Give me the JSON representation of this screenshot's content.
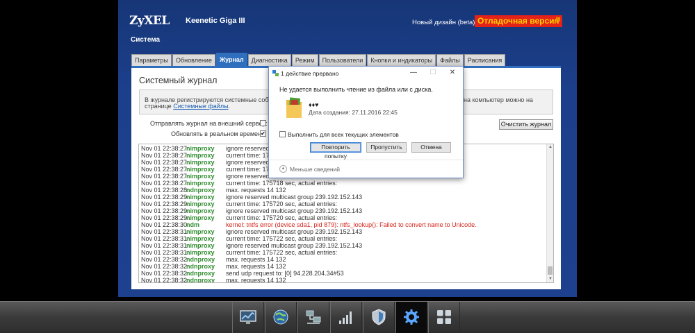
{
  "brand": {
    "logo": "ZyXEL",
    "model": "Keenetic Giga III"
  },
  "header": {
    "new_design": "Новый дизайн (beta)",
    "debug_badge": "Отладочная версия",
    "section_title": "Система"
  },
  "tabs": [
    {
      "label": "Параметры"
    },
    {
      "label": "Обновление"
    },
    {
      "label": "Журнал",
      "active": true
    },
    {
      "label": "Диагностика"
    },
    {
      "label": "Режим"
    },
    {
      "label": "Пользователи"
    },
    {
      "label": "Кнопки и индикаторы"
    },
    {
      "label": "Файлы"
    },
    {
      "label": "Расписания"
    }
  ],
  "panel": {
    "title": "Системный журнал",
    "info_line1": "В журнале регистрируются системные событи",
    "info_line1_right": "на компьютер можно на",
    "info_line2_prefix": "странице ",
    "info_link": "Системные файлы",
    "info_line2_suffix": ".",
    "opt_external_server": "Отправлять журнал на внешний сервер:",
    "opt_realtime": "Обновлять в реальном времени:",
    "opt_external_checked": false,
    "opt_realtime_checked": true,
    "clear_button": "Очистить журнал"
  },
  "log": [
    {
      "date": "Nov 01 22:38:27",
      "src": "nimproxy",
      "msg": "ignore reserved i"
    },
    {
      "date": "Nov 01 22:38:27",
      "src": "nimproxy",
      "msg": "current time: 175"
    },
    {
      "date": "Nov 01 22:38:27",
      "src": "nimproxy",
      "msg": "ignore reserved m"
    },
    {
      "date": "Nov 01 22:38:27",
      "src": "nimproxy",
      "msg": "current time: 175"
    },
    {
      "date": "Nov 01 22:38:27",
      "src": "nimproxy",
      "msg": "ignore reserved m"
    },
    {
      "date": "Nov 01 22:38:27",
      "src": "nimproxy",
      "msg": "current time: 175718 sec, actual entries:"
    },
    {
      "date": "Nov 01 22:38:28",
      "src": "ndnproxy",
      "msg": "max. requests 14 132"
    },
    {
      "date": "Nov 01 22:38:29",
      "src": "nimproxy",
      "msg": "ignore reserved multicast group 239.192.152.143"
    },
    {
      "date": "Nov 01 22:38:29",
      "src": "nimproxy",
      "msg": "current time: 175720 sec, actual entries:"
    },
    {
      "date": "Nov 01 22:38:29",
      "src": "nimproxy",
      "msg": "ignore reserved multicast group 239.192.152.143"
    },
    {
      "date": "Nov 01 22:38:29",
      "src": "nimproxy",
      "msg": "current time: 175720 sec, actual entries:"
    },
    {
      "date": "Nov 01 22:38:30",
      "src": "ndm",
      "msg": "kernel: tntfs error (device sda1, pid 879): ntfs_lookup(): Failed to convert name to Unicode.",
      "error": true
    },
    {
      "date": "Nov 01 22:38:31",
      "src": "nimproxy",
      "msg": "ignore reserved multicast group 239.192.152.143"
    },
    {
      "date": "Nov 01 22:38:31",
      "src": "nimproxy",
      "msg": "current time: 175722 sec, actual entries:"
    },
    {
      "date": "Nov 01 22:38:31",
      "src": "nimproxy",
      "msg": "ignore reserved multicast group 239.192.152.143"
    },
    {
      "date": "Nov 01 22:38:31",
      "src": "nimproxy",
      "msg": "current time: 175722 sec, actual entries:"
    },
    {
      "date": "Nov 01 22:38:32",
      "src": "ndnproxy",
      "msg": "max. requests 14 132"
    },
    {
      "date": "Nov 01 22:38:32",
      "src": "ndnproxy",
      "msg": "max. requests 14 132"
    },
    {
      "date": "Nov 01 22:38:32",
      "src": "ndnproxy",
      "msg": "send udp request to: [0] 94.228.204.34#53"
    },
    {
      "date": "Nov 01 22:38:32",
      "src": "ndnproxy",
      "msg": "max. requests 14 132"
    }
  ],
  "dialog": {
    "title": "1 действие прервано",
    "message": "Не удается выполнить чтение из файла или с диска.",
    "file_name": "♦♦♥",
    "file_date": "Дата создания: 27.11.2016 22:45",
    "apply_all": "Выполнить для всех текущих элементов",
    "btn_retry": "Повторить попытку",
    "btn_skip": "Пропустить",
    "btn_cancel": "Отмена",
    "less_details": "Меньше сведений",
    "minimize": "—",
    "maximize": "☐",
    "close": "✕"
  },
  "dock": [
    {
      "icon": "monitor-chart-icon"
    },
    {
      "icon": "globe-icon"
    },
    {
      "icon": "network-computers-icon"
    },
    {
      "icon": "signal-bars-icon"
    },
    {
      "icon": "shield-icon"
    },
    {
      "icon": "gear-icon",
      "active": true
    },
    {
      "icon": "apps-grid-icon"
    }
  ],
  "colors": {
    "frame": "#1d418e",
    "active_tab": "#2f6fbd",
    "debug_bg": "#e32219",
    "debug_text": "#ffd000",
    "log_source": "#2e8b2e",
    "log_error": "#d7271e"
  }
}
